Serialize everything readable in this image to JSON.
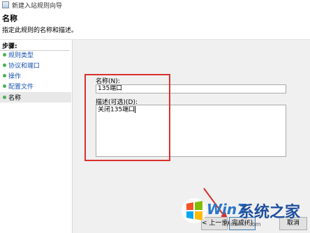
{
  "window": {
    "title": "新建入站规则向导"
  },
  "header": {
    "title": "名称",
    "subtitle": "指定此规则的名称和描述。"
  },
  "steps": {
    "heading": "步骤:",
    "items": [
      {
        "label": "规则类型"
      },
      {
        "label": "协议和端口"
      },
      {
        "label": "操作"
      },
      {
        "label": "配置文件"
      },
      {
        "label": "名称"
      }
    ]
  },
  "form": {
    "name_label": "名称(N):",
    "name_value": "135端口",
    "desc_label": "描述(可选)(D):",
    "desc_value": "关闭135端口"
  },
  "buttons": {
    "back": "< 上一步(B)",
    "finish": "完成(F)",
    "cancel": "取消"
  },
  "watermark": {
    "brand_win": "Win7",
    "brand_cn": "系统之家",
    "url": "Winwin7.com"
  },
  "colors": {
    "highlight": "#d9312b",
    "step_dot": "#4caf50",
    "link": "#1a55b0"
  }
}
